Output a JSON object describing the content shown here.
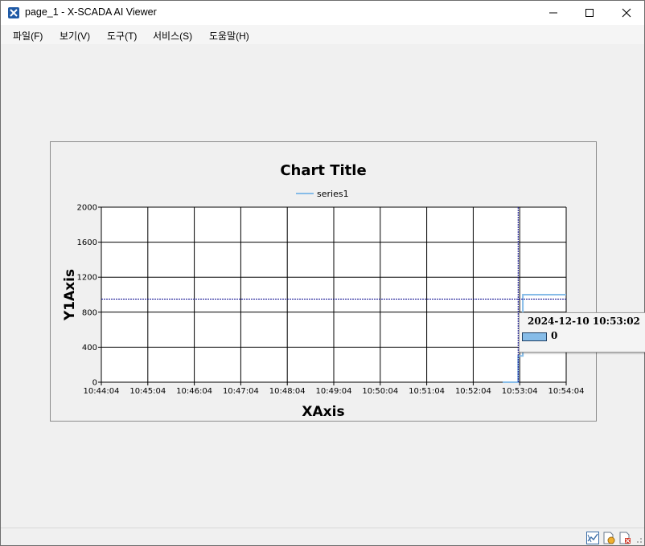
{
  "window": {
    "title": "page_1 - X-SCADA AI Viewer"
  },
  "menu": [
    {
      "label": "파일(F)"
    },
    {
      "label": "보기(V)"
    },
    {
      "label": "도구(T)"
    },
    {
      "label": "서비스(S)"
    },
    {
      "label": "도움말(H)"
    }
  ],
  "chart_data": {
    "type": "line",
    "title": "Chart Title",
    "xlabel": "XAxis",
    "ylabel": "Y1Axis",
    "x_ticks": [
      "10:44:04",
      "10:45:04",
      "10:46:04",
      "10:47:04",
      "10:48:04",
      "10:49:04",
      "10:50:04",
      "10:51:04",
      "10:52:04",
      "10:53:04",
      "10:54:04"
    ],
    "y_ticks": [
      0,
      400,
      800,
      1200,
      1600,
      2000
    ],
    "ylim": [
      0,
      2000
    ],
    "xlim": [
      "10:44:04",
      "10:54:04"
    ],
    "grid": true,
    "legend_position": "top-center",
    "series": [
      {
        "name": "series1",
        "color": "#86bce8",
        "x": [
          "10:52:42",
          "10:53:02",
          "10:53:02",
          "10:53:08",
          "10:53:08",
          "10:54:04"
        ],
        "y": [
          0,
          0,
          300,
          300,
          1000,
          1000
        ]
      }
    ],
    "crosshair": {
      "x": "10:53:02",
      "y": 950,
      "color": "#00008b"
    },
    "tooltip": {
      "time": "2024-12-10 10:53:02",
      "value": "0"
    }
  },
  "statusbar": {
    "icons": [
      "chart-icon",
      "document-icon",
      "close-document-icon"
    ]
  }
}
